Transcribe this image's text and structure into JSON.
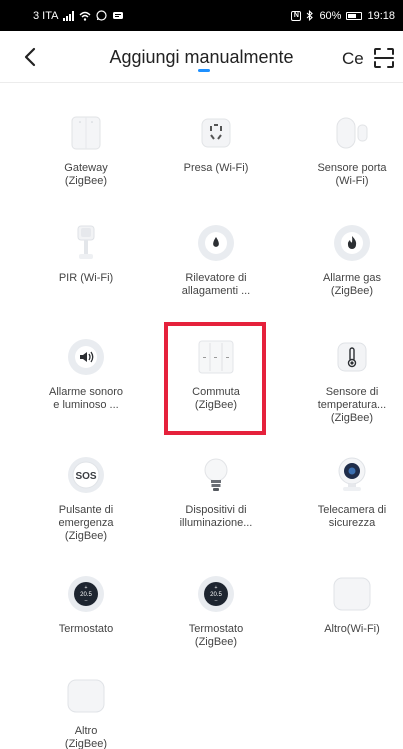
{
  "status_bar": {
    "carrier": "3 ITA",
    "battery": "60%",
    "time": "19:18"
  },
  "header": {
    "title": "Aggiungi manualmente",
    "tab_short": "Ce"
  },
  "colors": {
    "accent": "#1e90ff",
    "highlight": "#e5213b",
    "icon_circle": "#e9ecf0"
  },
  "devices": [
    {
      "label": "Gateway\n(ZigBee)",
      "icon": "gateway-icon"
    },
    {
      "label": "Presa (Wi-Fi)",
      "icon": "plug-icon"
    },
    {
      "label": "Sensore porta\n(Wi-Fi)",
      "icon": "door-sensor-icon"
    },
    {
      "label": "PIR (Wi-Fi)",
      "icon": "pir-sensor-icon"
    },
    {
      "label": "Rilevatore di\nallagamenti ...",
      "icon": "water-leak-icon"
    },
    {
      "label": "Allarme gas\n(ZigBee)",
      "icon": "gas-alarm-icon"
    },
    {
      "label": "Allarme sonoro\ne luminoso ...",
      "icon": "siren-icon"
    },
    {
      "label": "Commuta\n(ZigBee)",
      "icon": "switch-icon"
    },
    {
      "label": "Sensore di\ntemperatura...\n(ZigBee)",
      "icon": "thermometer-icon"
    },
    {
      "label": "Pulsante di\nemergenza\n(ZigBee)",
      "icon": "sos-icon"
    },
    {
      "label": "Dispositivi di\nilluminazione...",
      "icon": "bulb-icon"
    },
    {
      "label": "Telecamera di\nsicurezza",
      "icon": "camera-icon"
    },
    {
      "label": "Termostato",
      "icon": "thermostat-icon"
    },
    {
      "label": "Termostato\n(ZigBee)",
      "icon": "thermostat-icon"
    },
    {
      "label": "Altro(Wi-Fi)",
      "icon": "other-device-icon"
    },
    {
      "label": "Altro\n(ZigBee)",
      "icon": "other-device-icon"
    }
  ],
  "thermostat_display": "20.5"
}
